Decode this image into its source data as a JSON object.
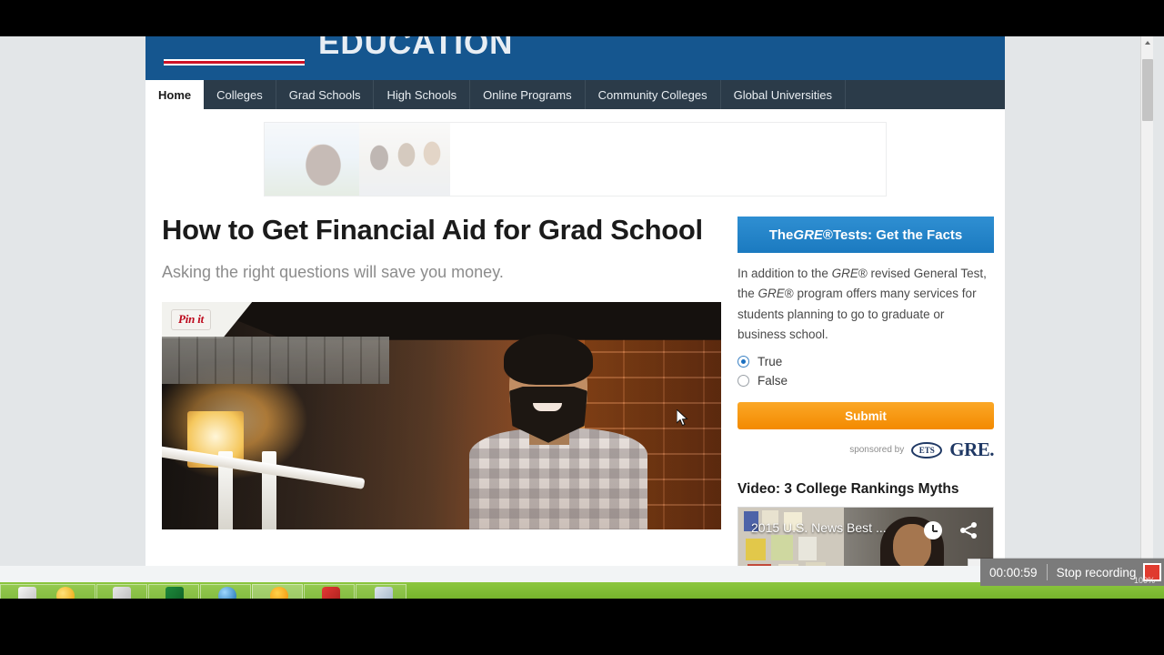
{
  "site": {
    "brand_word": "EDUCATION",
    "nav": [
      {
        "label": "Home",
        "active": true
      },
      {
        "label": "Colleges",
        "active": false
      },
      {
        "label": "Grad Schools",
        "active": false
      },
      {
        "label": "High Schools",
        "active": false
      },
      {
        "label": "Online Programs",
        "active": false
      },
      {
        "label": "Community Colleges",
        "active": false
      },
      {
        "label": "Global Universities",
        "active": false
      }
    ]
  },
  "article": {
    "headline": "How to Get Financial Aid for Grad School",
    "subhead": "Asking the right questions will save you money.",
    "pin_label": "Pin it"
  },
  "sidebar": {
    "gre": {
      "heading_pre": "The ",
      "heading_em": "GRE",
      "heading_reg": "®",
      "heading_post": " Tests: Get the Facts",
      "body_1": "In addition to the ",
      "body_em1": "GRE",
      "body_2": "® revised General Test, the ",
      "body_em2": "GRE",
      "body_3": "® program offers many services for students planning to go to graduate or business school.",
      "option_true": "True",
      "option_false": "False",
      "selected": "True",
      "submit_label": "Submit",
      "sponsor_text": "sponsored by",
      "ets_label": "ETS",
      "gre_label": "GRE."
    },
    "video": {
      "section_title": "Video: 3 College Rankings Myths",
      "player_title": "2015 U.S. News Best ...",
      "watch_later_icon": "clock-icon",
      "share_icon": "share-icon",
      "play_icon": "play-icon"
    }
  },
  "recording": {
    "elapsed": "00:00:59",
    "stop_label": "Stop recording",
    "zoom_level": "100%"
  },
  "colors": {
    "header_blue": "#15568f",
    "nav_dark": "#2b3b49",
    "accent_red": "#ce1126",
    "gre_blue": "#1b7ac0",
    "submit_orange": "#f38a00",
    "taskbar_green": "#7ab82f",
    "record_red": "#e03b2f"
  }
}
